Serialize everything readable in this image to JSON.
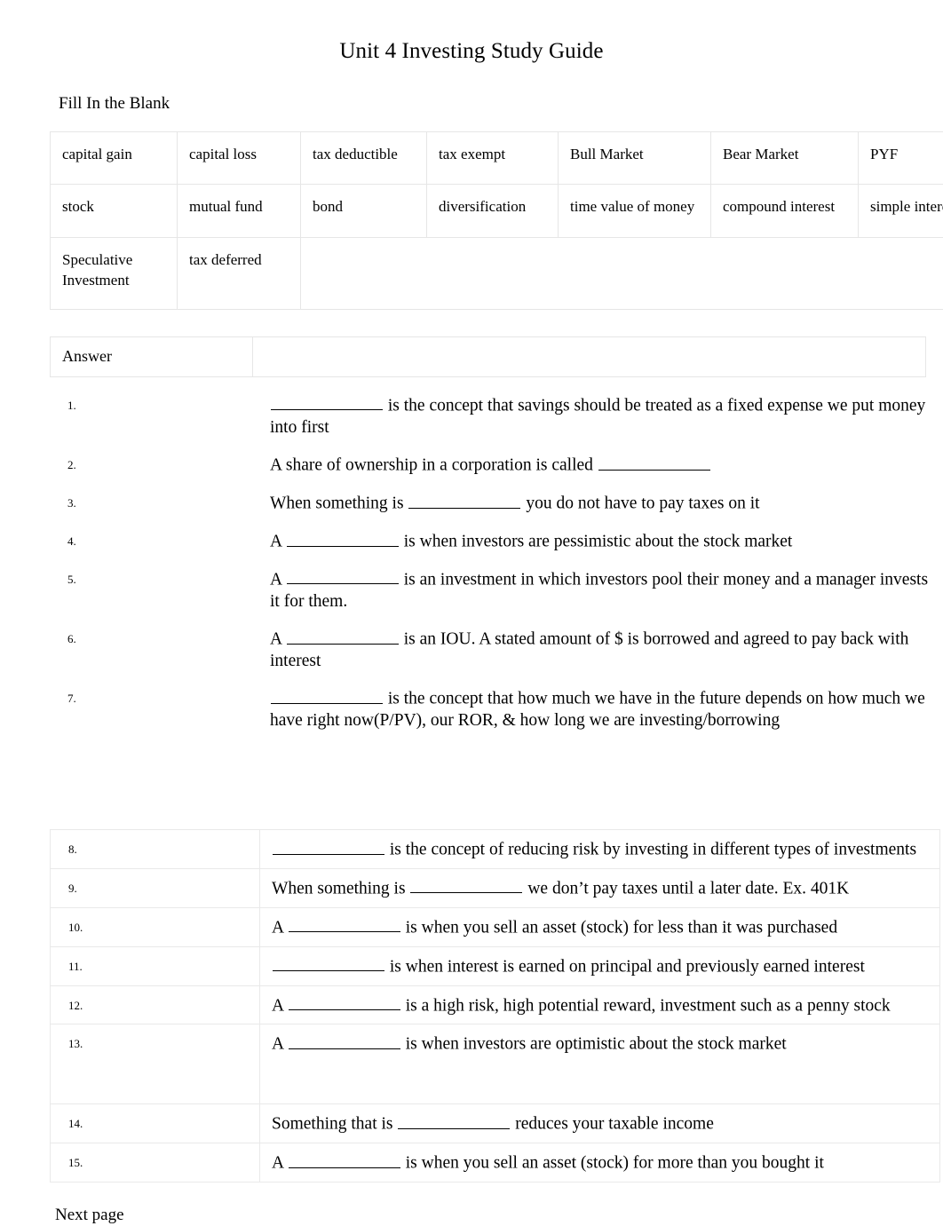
{
  "document": {
    "title": "Unit 4 Investing Study Guide",
    "section_label": "Fill In the Blank",
    "footer": "Next page"
  },
  "word_bank": {
    "rows": [
      [
        "capital gain",
        "capital loss",
        "tax deductible",
        "tax exempt",
        "Bull Market",
        "Bear Market",
        "PYF"
      ],
      [
        "stock",
        "mutual fund",
        "bond",
        "diversification",
        "time value of money",
        "compound interest",
        "simple interest"
      ],
      [
        "Speculative Investment",
        "tax deferred",
        ""
      ]
    ]
  },
  "answer_table": {
    "header_left": "Answer",
    "header_right": ""
  },
  "questions_upper": [
    {
      "number": "1.",
      "parts": [
        {
          "type": "blank"
        },
        {
          "type": "text",
          "value": " is the concept that savings should be treated as a fixed expense we put money into first"
        }
      ],
      "plain": "__________ is the concept that savings should be treated as a fixed expense we put money into first"
    },
    {
      "number": "2.",
      "parts": [
        {
          "type": "text",
          "value": "A share of ownership in a corporation is called "
        },
        {
          "type": "blank"
        }
      ],
      "plain": "A share of ownership in a corporation is called __________"
    },
    {
      "number": "3.",
      "parts": [
        {
          "type": "text",
          "value": "When something is "
        },
        {
          "type": "blank"
        },
        {
          "type": "text",
          "value": " you do not have to pay taxes on it"
        }
      ],
      "plain": "When something is __________ you do not have to pay taxes on it"
    },
    {
      "number": "4.",
      "parts": [
        {
          "type": "text",
          "value": "A "
        },
        {
          "type": "blank"
        },
        {
          "type": "text",
          "value": " is when investors are pessimistic about the stock market"
        }
      ],
      "plain": "A __________ is when investors are pessimistic about the stock market"
    },
    {
      "number": "5.",
      "parts": [
        {
          "type": "text",
          "value": "A "
        },
        {
          "type": "blank"
        },
        {
          "type": "text",
          "value": "  is an investment in which investors pool their money and a manager invests it for them."
        }
      ],
      "plain": "A __________  is an investment in which investors pool their money and a manager invests it for them."
    },
    {
      "number": "6.",
      "parts": [
        {
          "type": "text",
          "value": "A "
        },
        {
          "type": "blank"
        },
        {
          "type": "text",
          "value": " is an IOU.  A stated amount of $ is borrowed and agreed to pay back with interest"
        }
      ],
      "plain": "A __________ is an IOU.  A stated amount of $ is borrowed and agreed to pay back with interest"
    },
    {
      "number": "7.",
      "parts": [
        {
          "type": "blank"
        },
        {
          "type": "text",
          "value": " is the concept that how much we have in the future depends on how much we have right now(P/PV), our ROR, & how long we are investing/borrowing"
        }
      ],
      "plain": "__________ is the concept that how much we have in the future depends on how much we have right now(P/PV), our ROR, & how long we are investing/borrowing"
    }
  ],
  "questions_lower": [
    {
      "number": "8.",
      "parts": [
        {
          "type": "blank"
        },
        {
          "type": "text",
          "value": " is the concept of reducing risk by investing in different types of investments"
        }
      ],
      "plain": "__________ is the concept of reducing risk by investing in different types of investments"
    },
    {
      "number": "9.",
      "parts": [
        {
          "type": "text",
          "value": "When something is "
        },
        {
          "type": "blank"
        },
        {
          "type": "text",
          "value": " we don’t pay taxes until a later date.  Ex. 401K"
        }
      ],
      "plain": "When something is __________ we don’t pay taxes until a later date.  Ex. 401K"
    },
    {
      "number": "10.",
      "parts": [
        {
          "type": "text",
          "value": "A "
        },
        {
          "type": "blank"
        },
        {
          "type": "text",
          "value": " is when you sell an asset (stock) for less than it was purchased"
        }
      ],
      "plain": "A __________ is when you sell an asset (stock) for less than it was purchased"
    },
    {
      "number": "11.",
      "parts": [
        {
          "type": "blank"
        },
        {
          "type": "text",
          "value": " is when interest is earned on principal and previously earned interest"
        }
      ],
      "plain": "__________ is when interest is earned on principal and previously earned interest"
    },
    {
      "number": "12.",
      "parts": [
        {
          "type": "text",
          "value": "A "
        },
        {
          "type": "blank"
        },
        {
          "type": "text",
          "value": " is a high risk, high potential reward, investment such as a penny stock"
        }
      ],
      "plain": "A __________ is a high risk, high potential reward, investment such as a penny stock"
    },
    {
      "number": "13.",
      "parts": [
        {
          "type": "text",
          "value": "A "
        },
        {
          "type": "blank"
        },
        {
          "type": "text",
          "value": " is when investors are optimistic about the stock market"
        }
      ],
      "plain": "A __________ is when investors are optimistic about the stock market"
    },
    {
      "number": "14.",
      "parts": [
        {
          "type": "text",
          "value": "Something that is "
        },
        {
          "type": "blank"
        },
        {
          "type": "text",
          "value": " reduces your taxable income"
        }
      ],
      "plain": "Something that is __________ reduces your taxable income"
    },
    {
      "number": "15.",
      "parts": [
        {
          "type": "text",
          "value": "A "
        },
        {
          "type": "blank"
        },
        {
          "type": "text",
          "value": " is when you sell an asset (stock) for more than you bought it"
        }
      ],
      "plain": "A __________ is when you sell an asset (stock) for more than you bought it"
    }
  ],
  "colors": {
    "text": "#000000",
    "table_border": "#e6e6e6",
    "row_separator": "#e9e9e9",
    "page_background": "#ffffff"
  }
}
